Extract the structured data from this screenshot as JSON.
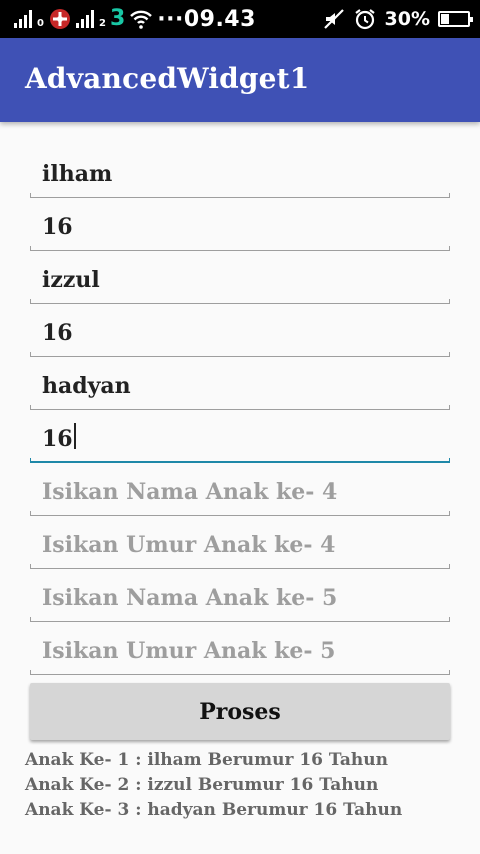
{
  "status_bar": {
    "sim1_number": "0",
    "sim2_number": "2",
    "network_label": "3",
    "time_text": "···09.43",
    "battery_text": "30%",
    "battery_level": 0.3,
    "icons": [
      "signal-icon",
      "sim-icon",
      "wifi-icon",
      "mute-icon",
      "alarm-icon",
      "battery-icon"
    ]
  },
  "app_bar": {
    "title": "AdvancedWidget1",
    "color": "#3f51b5"
  },
  "form": {
    "fields": [
      {
        "value": "ilham",
        "placeholder": ""
      },
      {
        "value": "16",
        "placeholder": ""
      },
      {
        "value": "izzul",
        "placeholder": ""
      },
      {
        "value": "16",
        "placeholder": ""
      },
      {
        "value": "hadyan",
        "placeholder": ""
      },
      {
        "value": "16",
        "placeholder": ""
      },
      {
        "value": "",
        "placeholder": "Isikan Nama Anak ke- 4"
      },
      {
        "value": "",
        "placeholder": "Isikan Umur Anak ke- 4"
      },
      {
        "value": "",
        "placeholder": "Isikan Nama Anak ke- 5"
      },
      {
        "value": "",
        "placeholder": "Isikan Umur Anak ke- 5"
      }
    ],
    "focus_color": "#1e88a8",
    "submit_label": "Proses"
  },
  "results": [
    "Anak Ke- 1 : ilham Berumur 16 Tahun",
    "Anak Ke- 2 : izzul Berumur 16 Tahun",
    "Anak Ke- 3 : hadyan Berumur 16 Tahun"
  ]
}
